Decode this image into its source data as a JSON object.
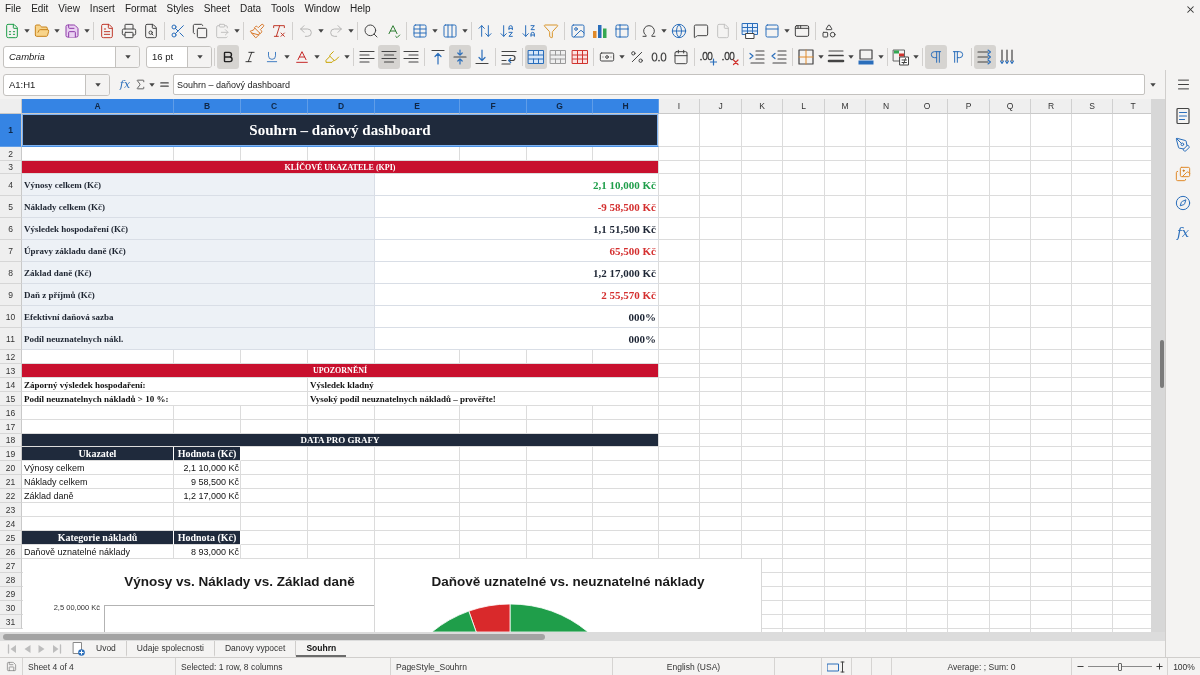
{
  "menu_bar": [
    "File",
    "Edit",
    "View",
    "Insert",
    "Format",
    "Styles",
    "Sheet",
    "Data",
    "Tools",
    "Window",
    "Help"
  ],
  "standard_toolbar": {
    "paste_disabled": true,
    "undo_disabled": true,
    "redo_disabled": true,
    "header_footer_disabled": true
  },
  "formatting_toolbar": {
    "font_name": "Cambria",
    "font_size": "16 pt",
    "bold": true,
    "italic": false,
    "underline": false,
    "align_left": false,
    "align_center": true,
    "align_right": false,
    "align_top": false,
    "align_middle": true,
    "align_bottom": false,
    "wrap_text": false,
    "merge_and_center": true,
    "paragraph_ltr": true,
    "paragraph_rtl": false,
    "text_horizontal": true,
    "text_vertical": false
  },
  "formula_bar": {
    "name_box": "A1:H1",
    "function_wizard": "fx",
    "content": "Souhrn – daňový dashboard"
  },
  "sidebar": {
    "functions": "fx"
  },
  "columns": [
    {
      "label": "A",
      "selected": true
    },
    {
      "label": "B",
      "selected": true
    },
    {
      "label": "C",
      "selected": true
    },
    {
      "label": "D",
      "selected": true
    },
    {
      "label": "E",
      "selected": true
    },
    {
      "label": "F",
      "selected": true
    },
    {
      "label": "G",
      "selected": true
    },
    {
      "label": "H",
      "selected": true
    },
    {
      "label": "I",
      "selected": false
    },
    {
      "label": "J",
      "selected": false
    },
    {
      "label": "K",
      "selected": false
    },
    {
      "label": "L",
      "selected": false
    },
    {
      "label": "M",
      "selected": false
    },
    {
      "label": "N",
      "selected": false
    },
    {
      "label": "O",
      "selected": false
    },
    {
      "label": "P",
      "selected": false
    },
    {
      "label": "Q",
      "selected": false
    },
    {
      "label": "R",
      "selected": false
    },
    {
      "label": "S",
      "selected": false
    },
    {
      "label": "T",
      "selected": false
    }
  ],
  "rows": [
    {
      "label": "1",
      "selected": true
    },
    {
      "label": "2",
      "selected": false
    },
    {
      "label": "3",
      "selected": false
    },
    {
      "label": "4",
      "selected": false
    },
    {
      "label": "5",
      "selected": false
    },
    {
      "label": "6",
      "selected": false
    },
    {
      "label": "7",
      "selected": false
    },
    {
      "label": "8",
      "selected": false
    },
    {
      "label": "9",
      "selected": false
    },
    {
      "label": "10",
      "selected": false
    },
    {
      "label": "11",
      "selected": false
    },
    {
      "label": "12",
      "selected": false
    },
    {
      "label": "13",
      "selected": false
    },
    {
      "label": "14",
      "selected": false
    },
    {
      "label": "15",
      "selected": false
    },
    {
      "label": "16",
      "selected": false
    },
    {
      "label": "17",
      "selected": false
    },
    {
      "label": "18",
      "selected": false
    },
    {
      "label": "19",
      "selected": false
    },
    {
      "label": "20",
      "selected": false
    },
    {
      "label": "21",
      "selected": false
    },
    {
      "label": "22",
      "selected": false
    },
    {
      "label": "23",
      "selected": false
    },
    {
      "label": "24",
      "selected": false
    },
    {
      "label": "25",
      "selected": false
    },
    {
      "label": "26",
      "selected": false
    },
    {
      "label": "27",
      "selected": false
    },
    {
      "label": "28",
      "selected": false
    },
    {
      "label": "29",
      "selected": false
    },
    {
      "label": "30",
      "selected": false
    },
    {
      "label": "31",
      "selected": false
    }
  ],
  "sheet": {
    "title": {
      "text": "Souhrn – daňový dashboard",
      "selected": true
    },
    "kpi_section": {
      "heading": "KLÍČOVÉ UKAZATELE (KPI)",
      "rows": [
        {
          "label": "Výnosy celkem (Kč)",
          "value": "2,1 10,000 Kč",
          "color": "#1f9e4a"
        },
        {
          "label": "Náklady celkem (Kč)",
          "value": "-9 58,500 Kč",
          "color": "#d42f2f"
        },
        {
          "label": "Výsledek hospodaření (Kč)",
          "value": "1,1 51,500 Kč",
          "color": "#1e2635"
        },
        {
          "label": "Úpravy základu daně (Kč)",
          "value": "65,500 Kč",
          "color": "#d42f2f"
        },
        {
          "label": "Základ daně (Kč)",
          "value": "1,2 17,000 Kč",
          "color": "#1e2635"
        },
        {
          "label": "Daň z příjmů (Kč)",
          "value": "2 55,570 Kč",
          "color": "#d42f2f"
        },
        {
          "label": "Efektivní daňová sazba",
          "value": "000%",
          "color": "#1e2635"
        },
        {
          "label": "Podíl neuznatelnych nákl.",
          "value": "000%",
          "color": "#1e2635"
        }
      ]
    },
    "alerts_section": {
      "heading": "UPOZORNĚNÍ",
      "rows": [
        {
          "label": "Záporný výsledek hospodaření:",
          "message": "Výsledek kladný"
        },
        {
          "label": "Podíl neuznatelnych nákladů > 10 %:",
          "message": "Vysoký podíl neuznatelnych nákladů – prověřte!"
        }
      ]
    },
    "chart_data_section": {
      "heading": "DATA PRO GRAFY",
      "tables": [
        {
          "columns": [
            "Ukazatel",
            "Hodnota (Kč)"
          ],
          "rows": [
            {
              "label": "Výnosy celkem",
              "value": "2,1 10,000 Kč"
            },
            {
              "label": "Náklady celkem",
              "value": "9 58,500 Kč"
            },
            {
              "label": "Základ daně",
              "value": "1,2 17,000 Kč"
            }
          ]
        },
        {
          "columns": [
            "Kategorie nákladů",
            "Hodnota (Kč)"
          ],
          "rows": [
            {
              "label": "Daňově uznatelné náklady",
              "value": "8 93,000 Kč"
            }
          ]
        }
      ]
    }
  },
  "charts": [
    {
      "kind": "axis",
      "title": "Výnosy vs. Náklady vs. Základ daně",
      "y_tick": "2,5 00,000 Kč"
    },
    {
      "kind": "pie",
      "title": "Daňově uznatelné vs. neuznatelné náklady",
      "slices": [
        {
          "color": "#1f9e4a"
        },
        {
          "color": "#d9292b"
        }
      ]
    }
  ],
  "sheet_tabs": [
    {
      "label": "Uvod",
      "selected": false
    },
    {
      "label": "Udaje spolecnosti",
      "selected": false
    },
    {
      "label": "Danovy vypocet",
      "selected": false
    },
    {
      "label": "Souhrn",
      "selected": true
    }
  ],
  "status_bar": {
    "sheet_position": "Sheet 4 of 4",
    "selection": "Selected: 1 row, 8 columns",
    "page_style": "PageStyle_Souhrn",
    "language": "English (USA)",
    "summary": "Average: ; Sum: 0",
    "zoom_slider": {
      "level": 0.5
    },
    "zoom": "100%"
  }
}
